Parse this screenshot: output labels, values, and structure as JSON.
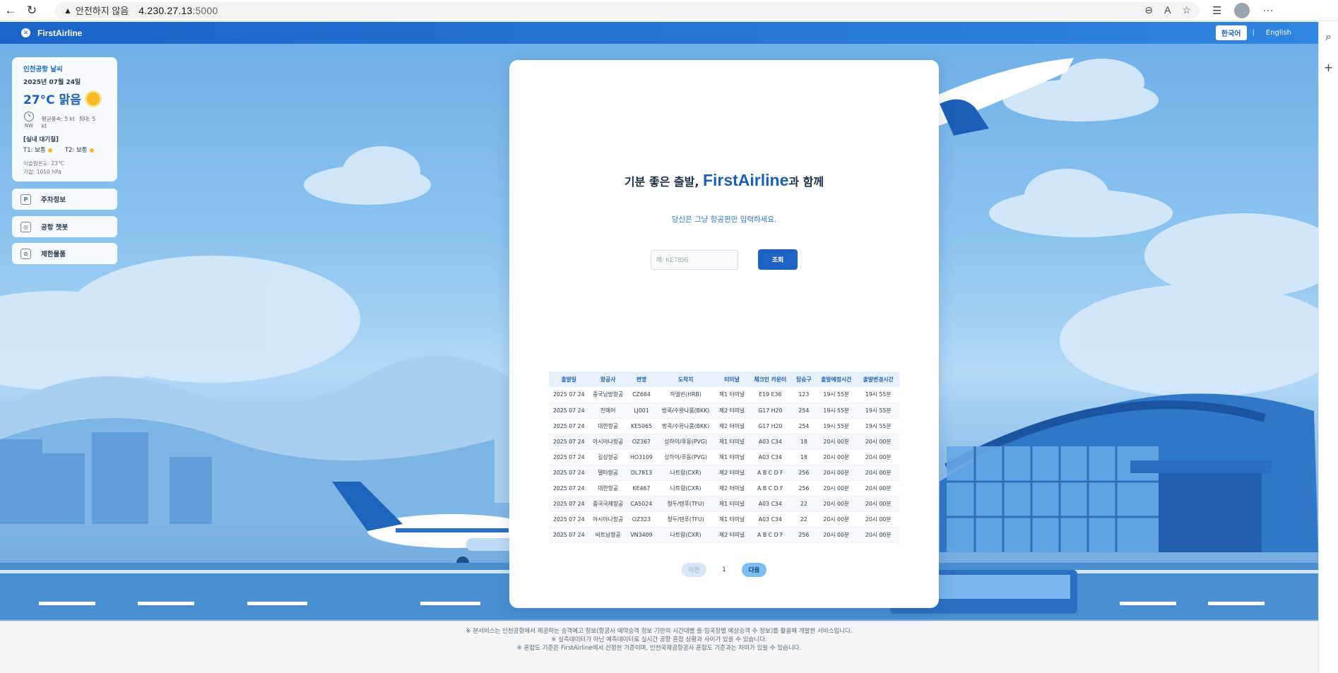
{
  "browser": {
    "back_glyph": "←",
    "reload_glyph": "↻",
    "warning_glyph": "▲",
    "insecure_label": "안전하지 않음",
    "url_host": "4.230.27.13",
    "url_port": ":5000",
    "zoom_glyph": "⊖",
    "read_glyph": "A",
    "star_glyph": "☆",
    "favorites_glyph": "☰",
    "more_glyph": "···",
    "rail_search_glyph": "⌕",
    "rail_add_glyph": "+"
  },
  "header": {
    "logo_glyph": "✕",
    "site_name": "FirstAirline",
    "lang_ko": "한국어",
    "lang_sep": "|",
    "lang_en": "English"
  },
  "weather": {
    "title": "인천공항 날씨",
    "date": "2025년 07월 24일",
    "temp": "27°C 맑음",
    "wind_dir": "NW",
    "wind_avg": "평균풍속: 5 kt",
    "wind_max": "최대: 5 kt",
    "wait_title": "[실내 대기질]",
    "t1": "T1: 보통",
    "t2": "T2: 보통",
    "indoor_temp": "이슬점온도: 23°C",
    "pressure": "기압: 1010 hPa"
  },
  "sidebar": {
    "items": [
      {
        "label": "주차정보",
        "icon": "P"
      },
      {
        "label": "공항 챗봇",
        "icon": "◎"
      },
      {
        "label": "제한물품",
        "icon": "⊘"
      }
    ]
  },
  "main": {
    "headline_prefix": "기분 좋은 출발, ",
    "headline_brand": "FirstAirline",
    "headline_suffix": "과 함께",
    "subline": "당신은 그냥 항공편만 입력하세요.",
    "search_placeholder": "예: KE7895",
    "search_value": "",
    "search_button": "조회"
  },
  "table": {
    "headers": [
      "출발일",
      "항공사",
      "편명",
      "도착지",
      "터미널",
      "체크인 카운터",
      "탑승구",
      "출발예정시간",
      "출발변경시간"
    ],
    "rows": [
      [
        "2025 07 24",
        "중국남방항공",
        "CZ684",
        "하얼빈(HRB)",
        "제1 터미널",
        "E19 E36",
        "123",
        "19시 55분",
        "19시 55분"
      ],
      [
        "2025 07 24",
        "진에어",
        "LJ001",
        "방콕/수완나품(BKK)",
        "제2 터미널",
        "G17 H20",
        "254",
        "19시 55분",
        "19시 55분"
      ],
      [
        "2025 07 24",
        "대한항공",
        "KE5065",
        "방콕/수완나품(BKK)",
        "제2 터미널",
        "G17 H20",
        "254",
        "19시 55분",
        "19시 55분"
      ],
      [
        "2025 07 24",
        "아시아나항공",
        "OZ367",
        "상하이/푸동(PVG)",
        "제1 터미널",
        "A03 C34",
        "18",
        "20시 00분",
        "20시 00분"
      ],
      [
        "2025 07 24",
        "길상항공",
        "HO3109",
        "상하이/푸동(PVG)",
        "제1 터미널",
        "A03 C34",
        "18",
        "20시 00분",
        "20시 00분"
      ],
      [
        "2025 07 24",
        "델타항공",
        "DL7813",
        "나트랑(CXR)",
        "제2 터미널",
        "A B C D F",
        "256",
        "20시 00분",
        "20시 00분"
      ],
      [
        "2025 07 24",
        "대한항공",
        "KE467",
        "나트랑(CXR)",
        "제2 터미널",
        "A B C D F",
        "256",
        "20시 00분",
        "20시 00분"
      ],
      [
        "2025 07 24",
        "중국국제항공",
        "CA5024",
        "청두/텐푸(TFU)",
        "제1 터미널",
        "A03 C34",
        "22",
        "20시 00분",
        "20시 00분"
      ],
      [
        "2025 07 24",
        "아시아나항공",
        "OZ323",
        "청두/텐푸(TFU)",
        "제1 터미널",
        "A03 C34",
        "22",
        "20시 00분",
        "20시 00분"
      ],
      [
        "2025 07 24",
        "비트남항공",
        "VN3409",
        "나트랑(CXR)",
        "제2 터미널",
        "A B C D F",
        "256",
        "20시 00분",
        "20시 00분"
      ]
    ]
  },
  "pager": {
    "prev": "이전",
    "page": "1",
    "next": "다음"
  },
  "footer": {
    "lines": [
      "※ 본서비스는 인천공항에서 제공하는 승객예고 정보(항공사 예약승객 정보 기반의 시간대별 출·입국장별 예상승객 수 정보)를 활용해 개발한 서비스입니다.",
      "※ 실측데이터가 아닌 예측데이터로 실시간 공항 혼잡 상황과 사이가 있을 수 있습니다.",
      "※ 혼잡도 기준은 FirstAirline에서 선정한 기준이며, 인천국제공항공사 혼잡도 기준과는 차이가 있을 수 있습니다."
    ]
  },
  "colors": {
    "brand": "#1b63c7",
    "accent": "#2f76d0",
    "sun": "#f7b924"
  }
}
